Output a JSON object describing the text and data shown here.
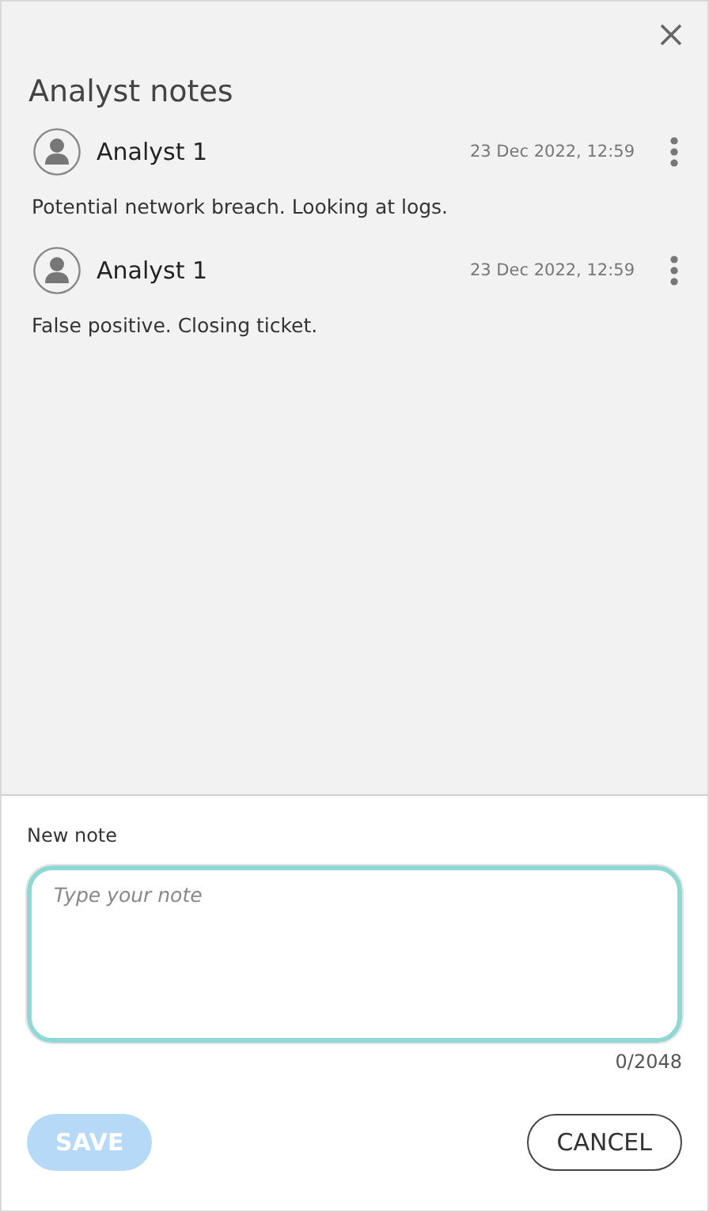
{
  "title": "Analyst notes",
  "notes": [
    {
      "author": "Analyst 1",
      "time": "23 Dec 2022, 12:59",
      "text": "Potential network breach. Looking at logs."
    },
    {
      "author": "Analyst 1",
      "time": "23 Dec 2022, 12:59",
      "text": "False positive. Closing ticket."
    }
  ],
  "new_note": {
    "label": "New note",
    "placeholder": "Type your note",
    "counter": "0/2048"
  },
  "buttons": [
    {
      "kind": "primary",
      "label": "SAVE",
      "disabled": true
    },
    {
      "kind": "outline",
      "label": "CANCEL",
      "disabled": false
    }
  ]
}
